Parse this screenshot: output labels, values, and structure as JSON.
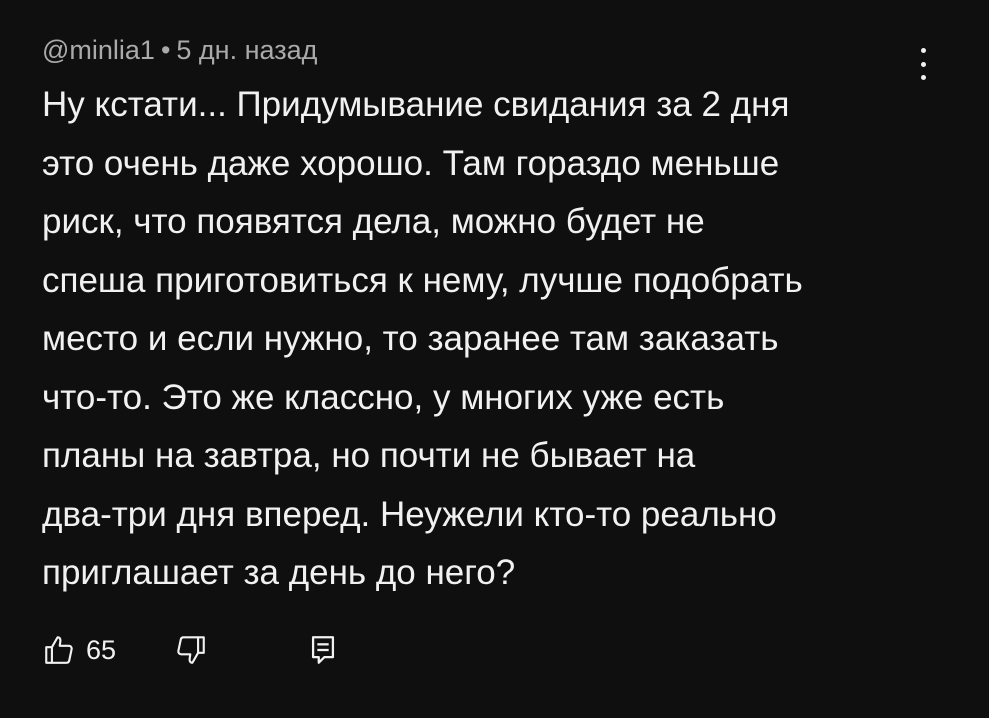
{
  "comment": {
    "author": "@minlia1",
    "separator": "•",
    "time": "5 дн. назад",
    "lines": [
      "Ну кстати... Придумывание свидания за 2 дня",
      "это очень даже хорошо. Там гораздо меньше",
      "риск, что появятся дела, можно будет не",
      "спеша приготовиться к нему, лучше подобрать",
      "место и если нужно, то заранее там заказать",
      "что-то. Это же классно, у многих уже есть",
      "планы на завтра, но почти не бывает на",
      "два-три дня вперед. Неужели кто-то реально",
      "приглашает за день до него?"
    ],
    "like_count": "65"
  },
  "icons": {
    "menu": "more-vertical-icon",
    "like": "thumbs-up-icon",
    "dislike": "thumbs-down-icon",
    "reply": "reply-icon"
  },
  "colors": {
    "background": "#0f0f0f",
    "text": "#f1f1f1",
    "meta": "#aaaaaa"
  }
}
